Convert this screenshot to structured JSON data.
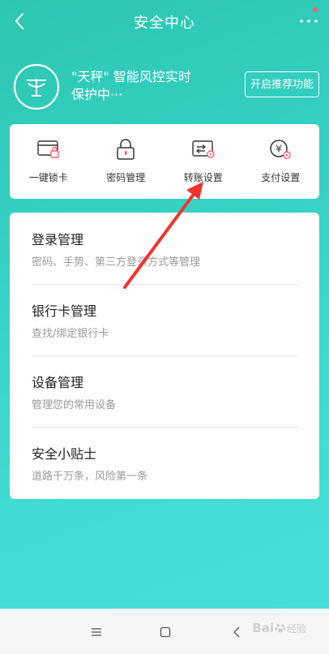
{
  "header": {
    "title": "安全中心"
  },
  "protection": {
    "line1": "\"天秤\" 智能风控实时",
    "line2": "保护中···",
    "button_label": "开启推荐功能"
  },
  "quick_actions": [
    {
      "label": "一键锁卡",
      "icon": "card-lock-icon"
    },
    {
      "label": "密码管理",
      "icon": "padlock-icon"
    },
    {
      "label": "转账设置",
      "icon": "transfer-icon"
    },
    {
      "label": "支付设置",
      "icon": "yuan-payment-icon"
    }
  ],
  "settings_list": [
    {
      "title": "登录管理",
      "subtitle": "密码、手势、第三方登录方式等管理"
    },
    {
      "title": "银行卡管理",
      "subtitle": "查找/绑定银行卡"
    },
    {
      "title": "设备管理",
      "subtitle": "管理您的常用设备"
    },
    {
      "title": "安全小贴士",
      "subtitle": "道路千万条，风险第一条"
    }
  ],
  "watermark": {
    "brand": "Bai",
    "suffix": "经验"
  },
  "colors": {
    "gradient_start": "#2cc6b0",
    "gradient_end": "#46dfd8",
    "badge": "#ff5a6e",
    "annotation_arrow": "#f0332f"
  }
}
